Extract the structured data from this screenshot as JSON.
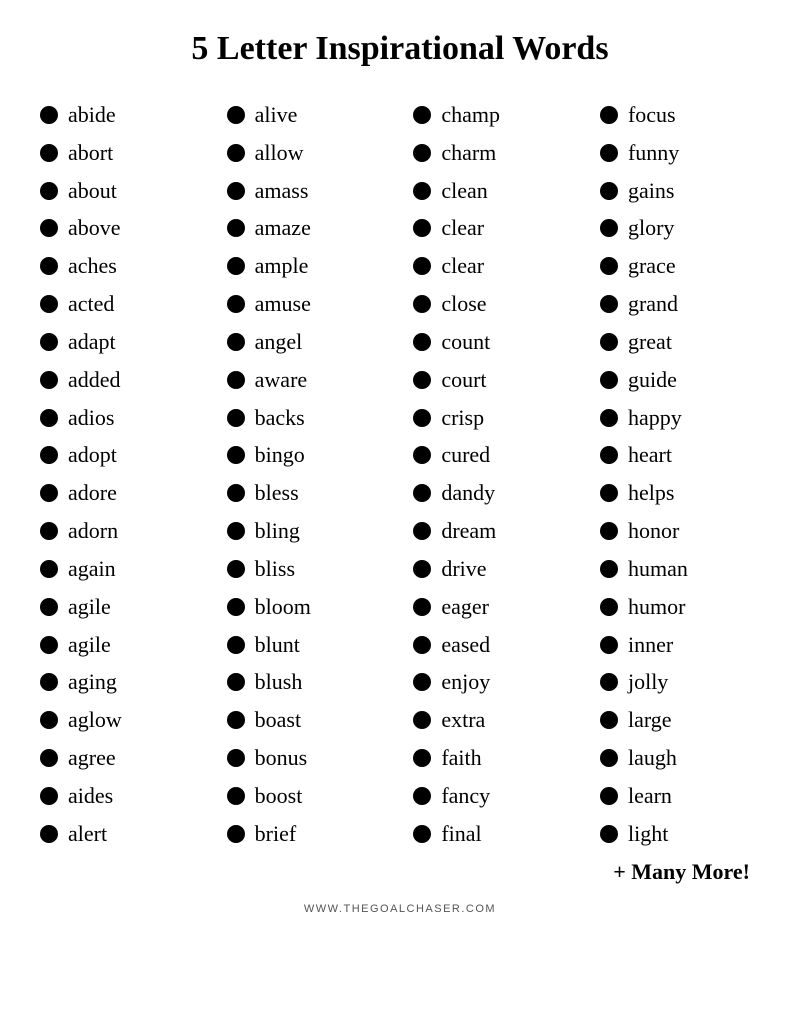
{
  "title": "5 Letter Inspirational Words",
  "footer": "WWW.THEGOALCHASER.COM",
  "more": "+ Many More!",
  "columns": [
    {
      "id": "col1",
      "words": [
        "abide",
        "abort",
        "about",
        "above",
        "aches",
        "acted",
        "adapt",
        "added",
        "adios",
        "adopt",
        "adore",
        "adorn",
        "again",
        "agile",
        "agile",
        "aging",
        "aglow",
        "agree",
        "aides",
        "alert"
      ]
    },
    {
      "id": "col2",
      "words": [
        "alive",
        "allow",
        "amass",
        "amaze",
        "ample",
        "amuse",
        "angel",
        "aware",
        "backs",
        "bingo",
        "bless",
        "bling",
        "bliss",
        "bloom",
        "blunt",
        "blush",
        "boast",
        "bonus",
        "boost",
        "brief"
      ]
    },
    {
      "id": "col3",
      "words": [
        "champ",
        "charm",
        "clean",
        "clear",
        "clear",
        "close",
        "count",
        "court",
        "crisp",
        "cured",
        "dandy",
        "dream",
        "drive",
        "eager",
        "eased",
        "enjoy",
        "extra",
        "faith",
        "fancy",
        "final"
      ]
    },
    {
      "id": "col4",
      "words": [
        "focus",
        "funny",
        "gains",
        "glory",
        "grace",
        "grand",
        "great",
        "guide",
        "happy",
        "heart",
        "helps",
        "honor",
        "human",
        "humor",
        "inner",
        "jolly",
        "large",
        "laugh",
        "learn",
        "light"
      ]
    }
  ]
}
